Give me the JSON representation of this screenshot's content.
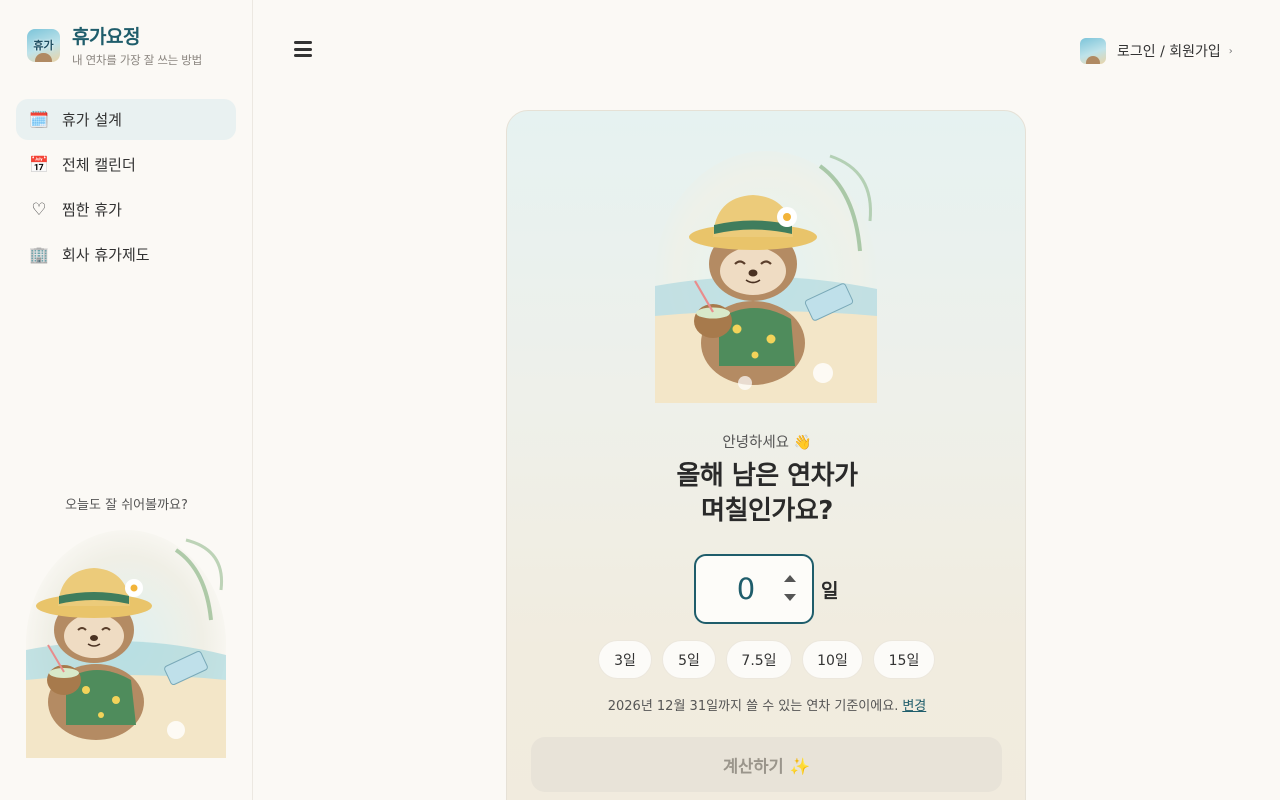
{
  "brand": {
    "logo_text": "휴가",
    "title": "휴가요정",
    "subtitle": "내 연차를 가장 잘 쓰는 방법"
  },
  "sidebar": {
    "items": [
      {
        "icon": "calendar-spiral-icon",
        "glyph": "🗓️",
        "label": "휴가 설계",
        "active": true
      },
      {
        "icon": "calendar-icon",
        "glyph": "📅",
        "label": "전체 캘린더",
        "active": false
      },
      {
        "icon": "heart-icon",
        "glyph": "♡",
        "label": "찜한 휴가",
        "active": false
      },
      {
        "icon": "office-building-icon",
        "glyph": "🏢",
        "label": "회사 휴가제도",
        "active": false
      }
    ],
    "footer_text": "오늘도 잘 쉬어볼까요?"
  },
  "header": {
    "login_label": "로그인 / 회원가입",
    "chevron": "›"
  },
  "main": {
    "greeting": "안녕하세요 👋",
    "question_line1": "올해 남은 연차가",
    "question_line2": "며칠인가요?",
    "days_value": "0",
    "unit": "일",
    "presets": [
      "3일",
      "5일",
      "7.5일",
      "10일",
      "15일"
    ],
    "note": "2026년 12월 31일까지 쓸 수 있는 연차 기준이에요.",
    "note_link": "변경",
    "calculate_label": "계산하기 ✨"
  },
  "colors": {
    "accent": "#1f5d6b",
    "active_nav_bg": "#e9f1f1",
    "disabled_button_bg": "#e8e3d8"
  }
}
